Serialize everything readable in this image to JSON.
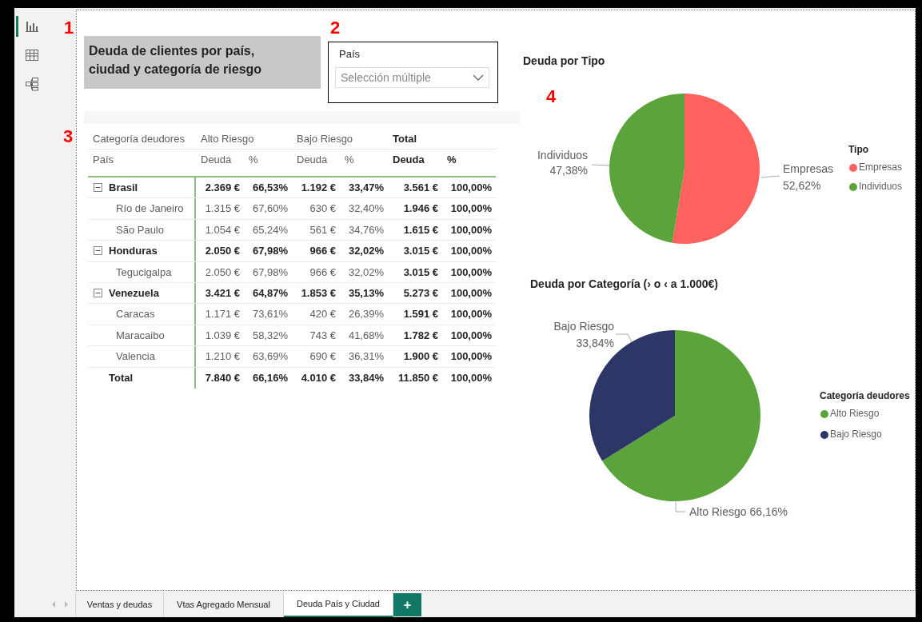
{
  "annotations": [
    "1",
    "2",
    "3",
    "4"
  ],
  "nav_rail": [
    {
      "kind": "report",
      "selected": true
    },
    {
      "kind": "data",
      "selected": false
    },
    {
      "kind": "model",
      "selected": false
    }
  ],
  "title_card": {
    "text": "Deuda de clientes por país, ciudad y categoría de riesgo"
  },
  "slicer": {
    "label": "País",
    "value": "Selección múltiple"
  },
  "matrix": {
    "column_groups": [
      "Categoría deudores",
      "Alto Riesgo",
      "Bajo Riesgo",
      "Total"
    ],
    "columns": [
      "País",
      "Deuda",
      "%",
      "Deuda",
      "%",
      "Deuda",
      "%"
    ],
    "rows": [
      {
        "kind": "country",
        "expanded": true,
        "label": "Brasil",
        "values": [
          "2.369 €",
          "66,53%",
          "1.192 €",
          "33,47%",
          "3.561 €",
          "100,00%"
        ]
      },
      {
        "kind": "city",
        "label": "Río de Janeiro",
        "values": [
          "1.315 €",
          "67,60%",
          "630 €",
          "32,40%",
          "1.946 €",
          "100,00%"
        ]
      },
      {
        "kind": "city",
        "label": "São Paulo",
        "values": [
          "1.054 €",
          "65,24%",
          "561 €",
          "34,76%",
          "1.615 €",
          "100,00%"
        ]
      },
      {
        "kind": "country",
        "expanded": true,
        "label": "Honduras",
        "values": [
          "2.050 €",
          "67,98%",
          "966 €",
          "32,02%",
          "3.015 €",
          "100,00%"
        ]
      },
      {
        "kind": "city",
        "label": "Tegucigalpa",
        "values": [
          "2.050 €",
          "67,98%",
          "966 €",
          "32,02%",
          "3.015 €",
          "100,00%"
        ]
      },
      {
        "kind": "country",
        "expanded": true,
        "label": "Venezuela",
        "values": [
          "3.421 €",
          "64,87%",
          "1.853 €",
          "35,13%",
          "5.273 €",
          "100,00%"
        ]
      },
      {
        "kind": "city",
        "label": "Caracas",
        "values": [
          "1.171 €",
          "73,61%",
          "420 €",
          "26,39%",
          "1.591 €",
          "100,00%"
        ]
      },
      {
        "kind": "city",
        "label": "Maracaibo",
        "values": [
          "1.039 €",
          "58,32%",
          "743 €",
          "41,68%",
          "1.782 €",
          "100,00%"
        ]
      },
      {
        "kind": "city",
        "label": "Valencia",
        "values": [
          "1.210 €",
          "63,69%",
          "690 €",
          "36,31%",
          "1.900 €",
          "100,00%"
        ]
      },
      {
        "kind": "total",
        "label": "Total",
        "values": [
          "7.840 €",
          "66,16%",
          "4.010 €",
          "33,84%",
          "11.850 €",
          "100,00%"
        ]
      }
    ]
  },
  "charts": [
    {
      "title": "Deuda por Tipo",
      "chart_data": {
        "type": "pie",
        "categories": [
          "Empresas",
          "Individuos"
        ],
        "values": [
          52.62,
          47.38
        ],
        "value_labels": [
          "52,62%",
          "47,38%"
        ]
      },
      "legend": {
        "title": "Tipo",
        "items": [
          {
            "label": "Empresas",
            "color": "#fd625e"
          },
          {
            "label": "Individuos",
            "color": "#5ba33b"
          }
        ]
      }
    },
    {
      "title": "Deuda por Categoría (› o ‹ a 1.000€)",
      "chart_data": {
        "type": "pie",
        "categories": [
          "Alto Riesgo",
          "Bajo Riesgo"
        ],
        "values": [
          66.16,
          33.84
        ],
        "value_labels": [
          "66,16%",
          "33,84%"
        ]
      },
      "legend": {
        "title": "Categoría deudores",
        "items": [
          {
            "label": "Alto Riesgo",
            "color": "#5ba33b"
          },
          {
            "label": "Bajo Riesgo",
            "color": "#2c3667"
          }
        ]
      }
    }
  ],
  "page_tabs": [
    {
      "label": "Ventas y deudas",
      "selected": false
    },
    {
      "label": "Vtas Agregado Mensual",
      "selected": false
    },
    {
      "label": "Deuda País y Ciudad",
      "selected": true
    }
  ],
  "add_page_button": "+"
}
